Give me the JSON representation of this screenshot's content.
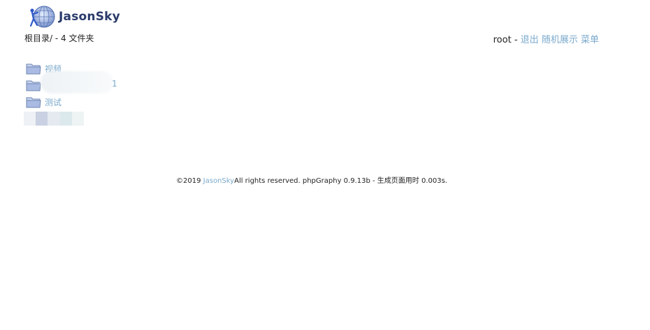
{
  "header": {
    "logo_text": "JasonSky",
    "breadcrumb": "根目录/ - 4 文件夹"
  },
  "user_bar": {
    "username": "root",
    "separator": " - ",
    "logout_label": "退出",
    "random_label": "随机展示",
    "menu_label": "菜单"
  },
  "folders": [
    {
      "label": "视频",
      "icon": "folder-icon"
    },
    {
      "label": "1",
      "icon": "folder-icon",
      "redacted": true
    },
    {
      "label": "测试",
      "icon": "folder-icon"
    }
  ],
  "footer": {
    "copyright": "©2019 ",
    "site_link": "JasonSky",
    "rest": "All rights reserved. phpGraphy 0.9.13b - 生成页面用时 0.003s."
  },
  "colors": {
    "link": "#7aa9cc",
    "text": "#222222",
    "logo_text": "#2a3a6a",
    "folder_fill": "#b9c8e6",
    "folder_stroke": "#6f86b3"
  }
}
